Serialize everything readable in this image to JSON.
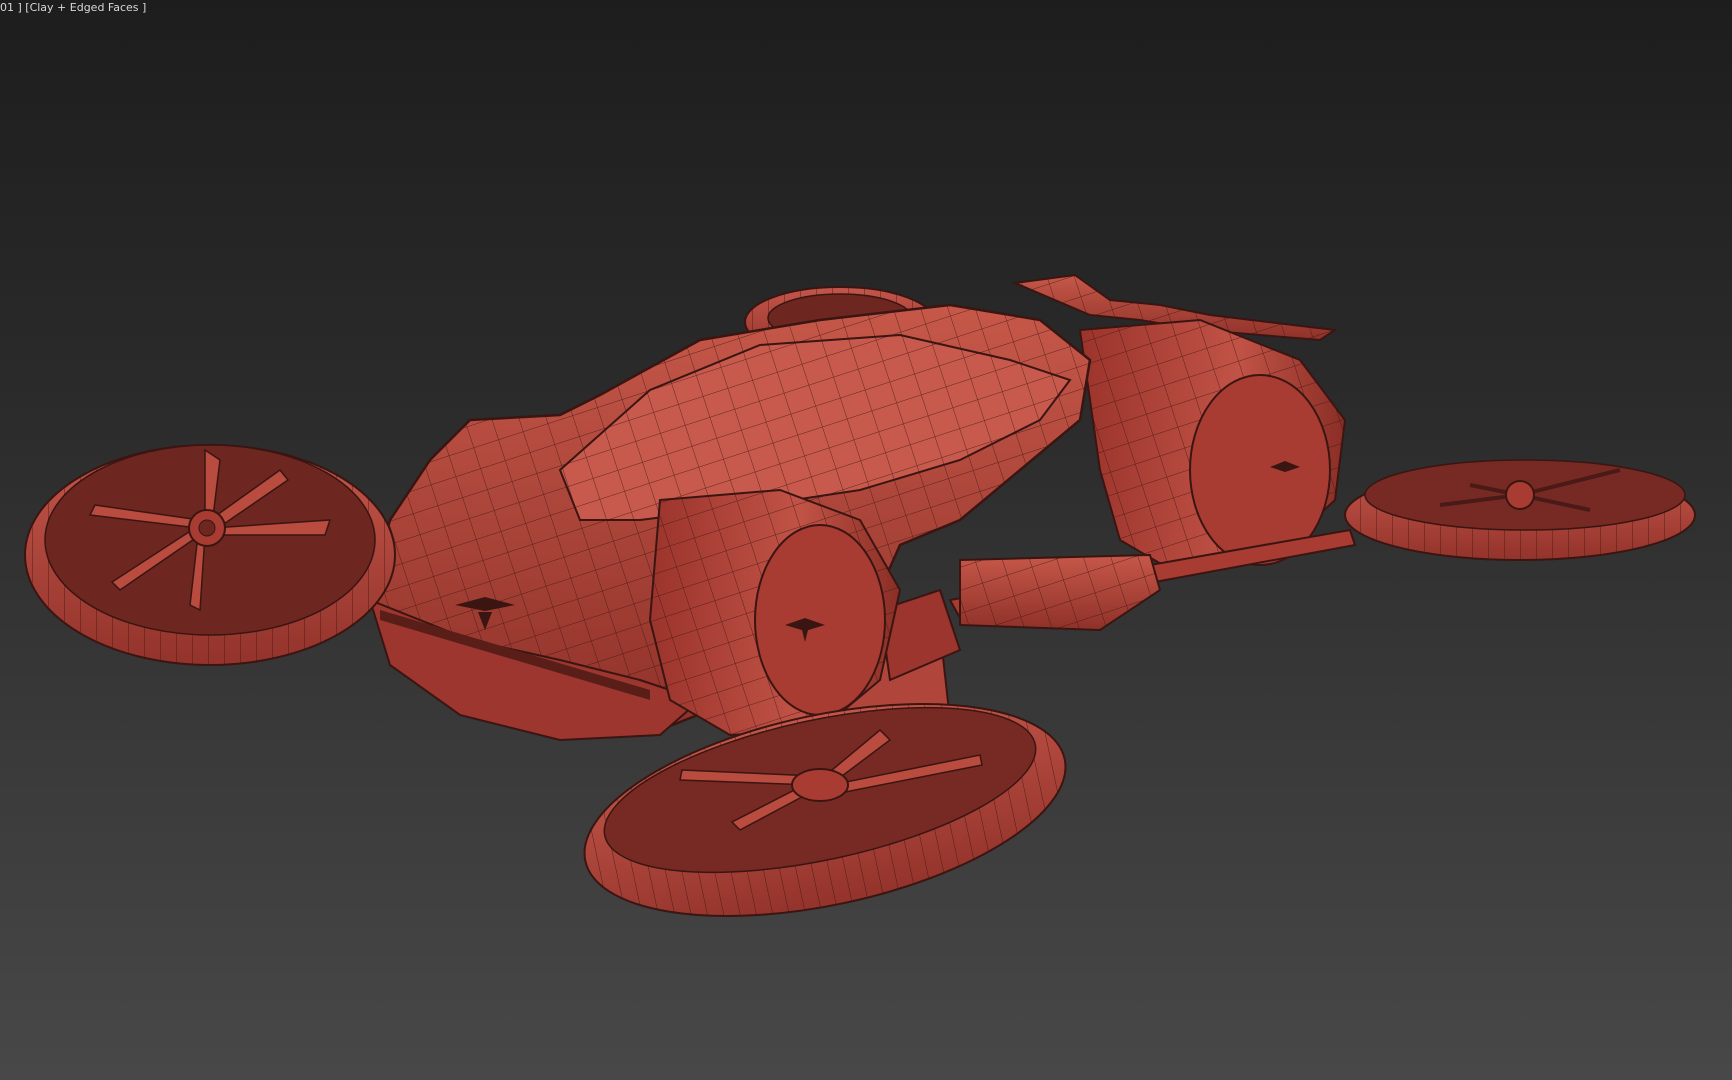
{
  "viewport": {
    "label": "01 ] [Clay + Edged Faces ]",
    "shading_mode": "Clay + Edged Faces",
    "background_top": "#1d1d1d",
    "background_bottom": "#484848"
  },
  "model": {
    "clay_color": "#b5463c",
    "edge_color": "#3a1512"
  },
  "icons": {
    "model": "flying-car-mesh-icon"
  }
}
